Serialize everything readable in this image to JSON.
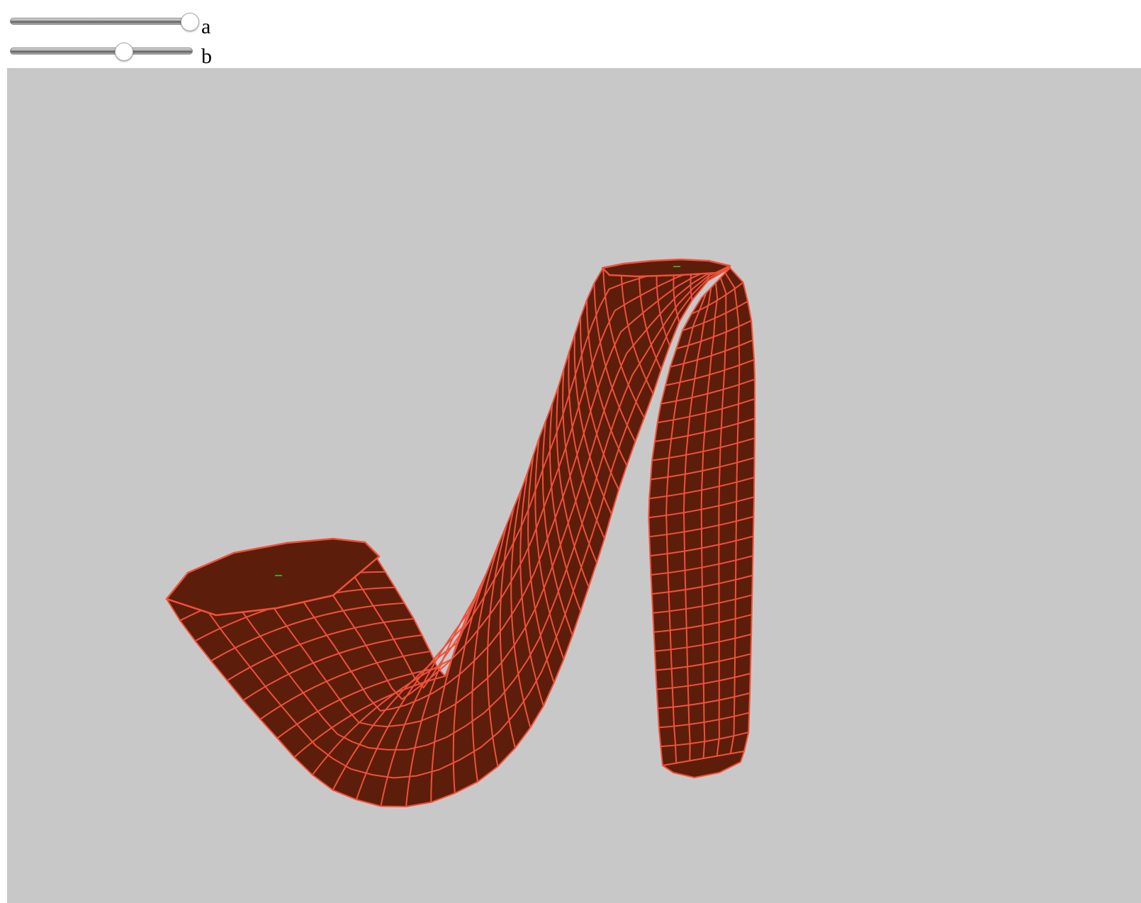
{
  "sliders": [
    {
      "label": "a",
      "value_fraction": 0.98
    },
    {
      "label": "b",
      "value_fraction": 0.62
    }
  ],
  "scene": {
    "background_color": "#c8c8c8",
    "surface_fill_color": "#5c1e0b",
    "mesh_line_color": "#f0503a",
    "marker_color": "#33cc33"
  }
}
